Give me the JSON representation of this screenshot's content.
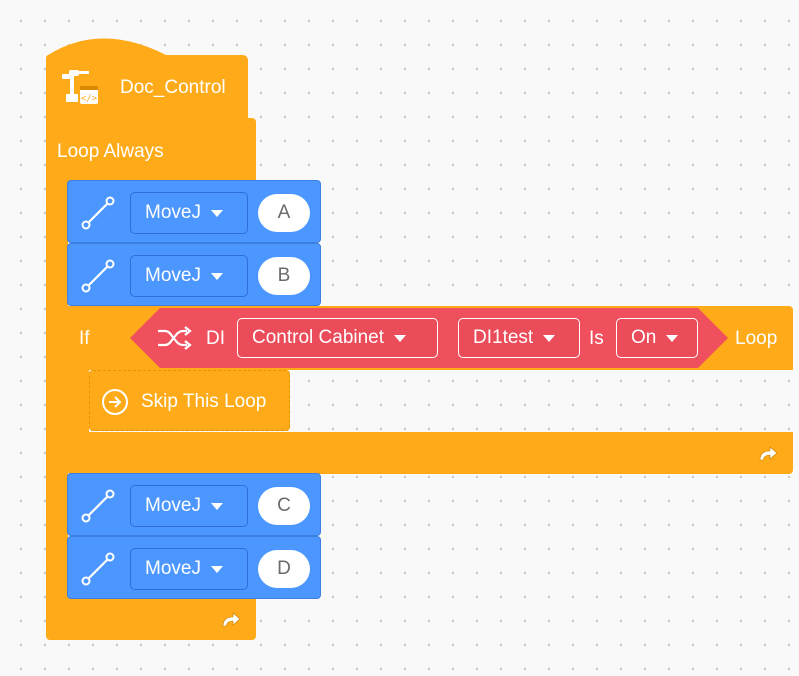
{
  "hat": {
    "label": "Doc_Control",
    "icon": "robot-arm-code-icon"
  },
  "loop": {
    "label": "Loop Always",
    "icon": "loop-return-icon"
  },
  "moves_top": [
    {
      "command": "MoveJ",
      "target": "A"
    },
    {
      "command": "MoveJ",
      "target": "B"
    }
  ],
  "if_block": {
    "label": "If",
    "condition": {
      "icon": "shuffle-icon",
      "prefix": "DI",
      "device": "Control Cabinet",
      "signal": "DI1test",
      "is_label": "Is",
      "state": "On"
    },
    "suffix": "Loop",
    "body": {
      "label": "Skip This Loop",
      "icon": "arrow-circle-right-icon"
    }
  },
  "moves_bottom": [
    {
      "command": "MoveJ",
      "target": "C"
    },
    {
      "command": "MoveJ",
      "target": "D"
    }
  ],
  "colors": {
    "control": "#ffab19",
    "motion": "#4c97ff",
    "io": "#f0505e"
  }
}
